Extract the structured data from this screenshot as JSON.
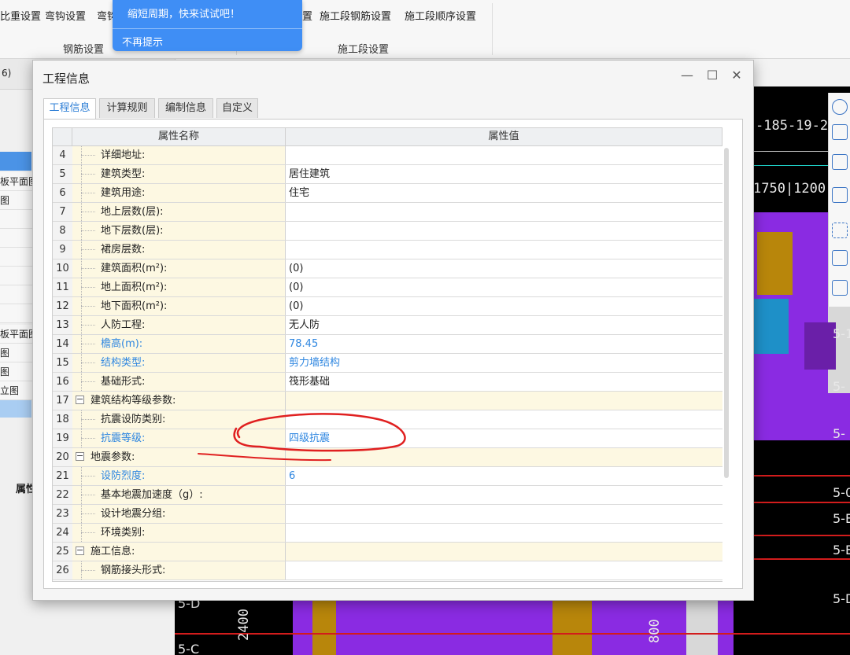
{
  "ribbon": {
    "items_left": [
      "比重设置",
      "弯钩设置",
      "弯钩"
    ],
    "items_right": [
      "置",
      "施工段钢筋设置",
      "施工段顺序设置"
    ],
    "group_rebar": "钢筋设置",
    "group_section": "施工段设置"
  },
  "toast": {
    "message": "缩短周期，快来试试吧！",
    "dismiss": "不再提示"
  },
  "left_panel": {
    "header": "6)",
    "rows": [
      "板平面图",
      "图",
      "板平面图",
      "图",
      "图",
      "立图"
    ],
    "property_label": "属性"
  },
  "cad": {
    "dims_top": "-185-19-2(",
    "dims_mid": "1750|1200|",
    "labels": [
      "5-1",
      "5-",
      "5-",
      "5-0",
      "5-E",
      "5-E",
      "5-D",
      "5-D",
      "5-C"
    ],
    "bottom_dims": [
      "2400",
      "800"
    ]
  },
  "dialog": {
    "title": "工程信息",
    "minimize": "—",
    "maximize": "☐",
    "close": "✕",
    "tabs": [
      "工程信息",
      "计算规则",
      "编制信息",
      "自定义"
    ],
    "active_tab": 0,
    "columns": {
      "name": "属性名称",
      "value": "属性值"
    },
    "rows": [
      {
        "num": "4",
        "name": "详细地址:",
        "value": "",
        "blue": false,
        "group": false
      },
      {
        "num": "5",
        "name": "建筑类型:",
        "value": "居住建筑",
        "blue": false,
        "group": false
      },
      {
        "num": "6",
        "name": "建筑用途:",
        "value": "住宅",
        "blue": false,
        "group": false
      },
      {
        "num": "7",
        "name": "地上层数(层):",
        "value": "",
        "blue": false,
        "group": false
      },
      {
        "num": "8",
        "name": "地下层数(层):",
        "value": "",
        "blue": false,
        "group": false
      },
      {
        "num": "9",
        "name": "裙房层数:",
        "value": "",
        "blue": false,
        "group": false
      },
      {
        "num": "10",
        "name": "建筑面积(m²):",
        "value": "(0)",
        "blue": false,
        "group": false
      },
      {
        "num": "11",
        "name": "地上面积(m²):",
        "value": "(0)",
        "blue": false,
        "group": false
      },
      {
        "num": "12",
        "name": "地下面积(m²):",
        "value": "(0)",
        "blue": false,
        "group": false
      },
      {
        "num": "13",
        "name": "人防工程:",
        "value": "无人防",
        "blue": false,
        "group": false
      },
      {
        "num": "14",
        "name": "檐高(m):",
        "value": "78.45",
        "blue": true,
        "group": false
      },
      {
        "num": "15",
        "name": "结构类型:",
        "value": "剪力墙结构",
        "blue": true,
        "group": false
      },
      {
        "num": "16",
        "name": "基础形式:",
        "value": "筏形基础",
        "blue": false,
        "group": false
      },
      {
        "num": "17",
        "name": "建筑结构等级参数:",
        "value": "",
        "blue": false,
        "group": true
      },
      {
        "num": "18",
        "name": "抗震设防类别:",
        "value": "",
        "blue": false,
        "group": false
      },
      {
        "num": "19",
        "name": "抗震等级:",
        "value": "四级抗震",
        "blue": true,
        "group": false
      },
      {
        "num": "20",
        "name": "地震参数:",
        "value": "",
        "blue": false,
        "group": true
      },
      {
        "num": "21",
        "name": "设防烈度:",
        "value": "6",
        "blue": true,
        "group": false
      },
      {
        "num": "22",
        "name": "基本地震加速度（g）:",
        "value": "",
        "blue": false,
        "group": false
      },
      {
        "num": "23",
        "name": "设计地震分组:",
        "value": "",
        "blue": false,
        "group": false
      },
      {
        "num": "24",
        "name": "环境类别:",
        "value": "",
        "blue": false,
        "group": false
      },
      {
        "num": "25",
        "name": "施工信息:",
        "value": "",
        "blue": false,
        "group": true
      },
      {
        "num": "26",
        "name": "钢筋接头形式:",
        "value": "",
        "blue": false,
        "group": false
      }
    ],
    "expander_symbol": "−"
  },
  "colors": {
    "accent_blue": "#2e86e0",
    "toast_blue": "#3f8ef5",
    "name_column_bg": "#fdf8e2",
    "annotation_red": "#e02020"
  }
}
